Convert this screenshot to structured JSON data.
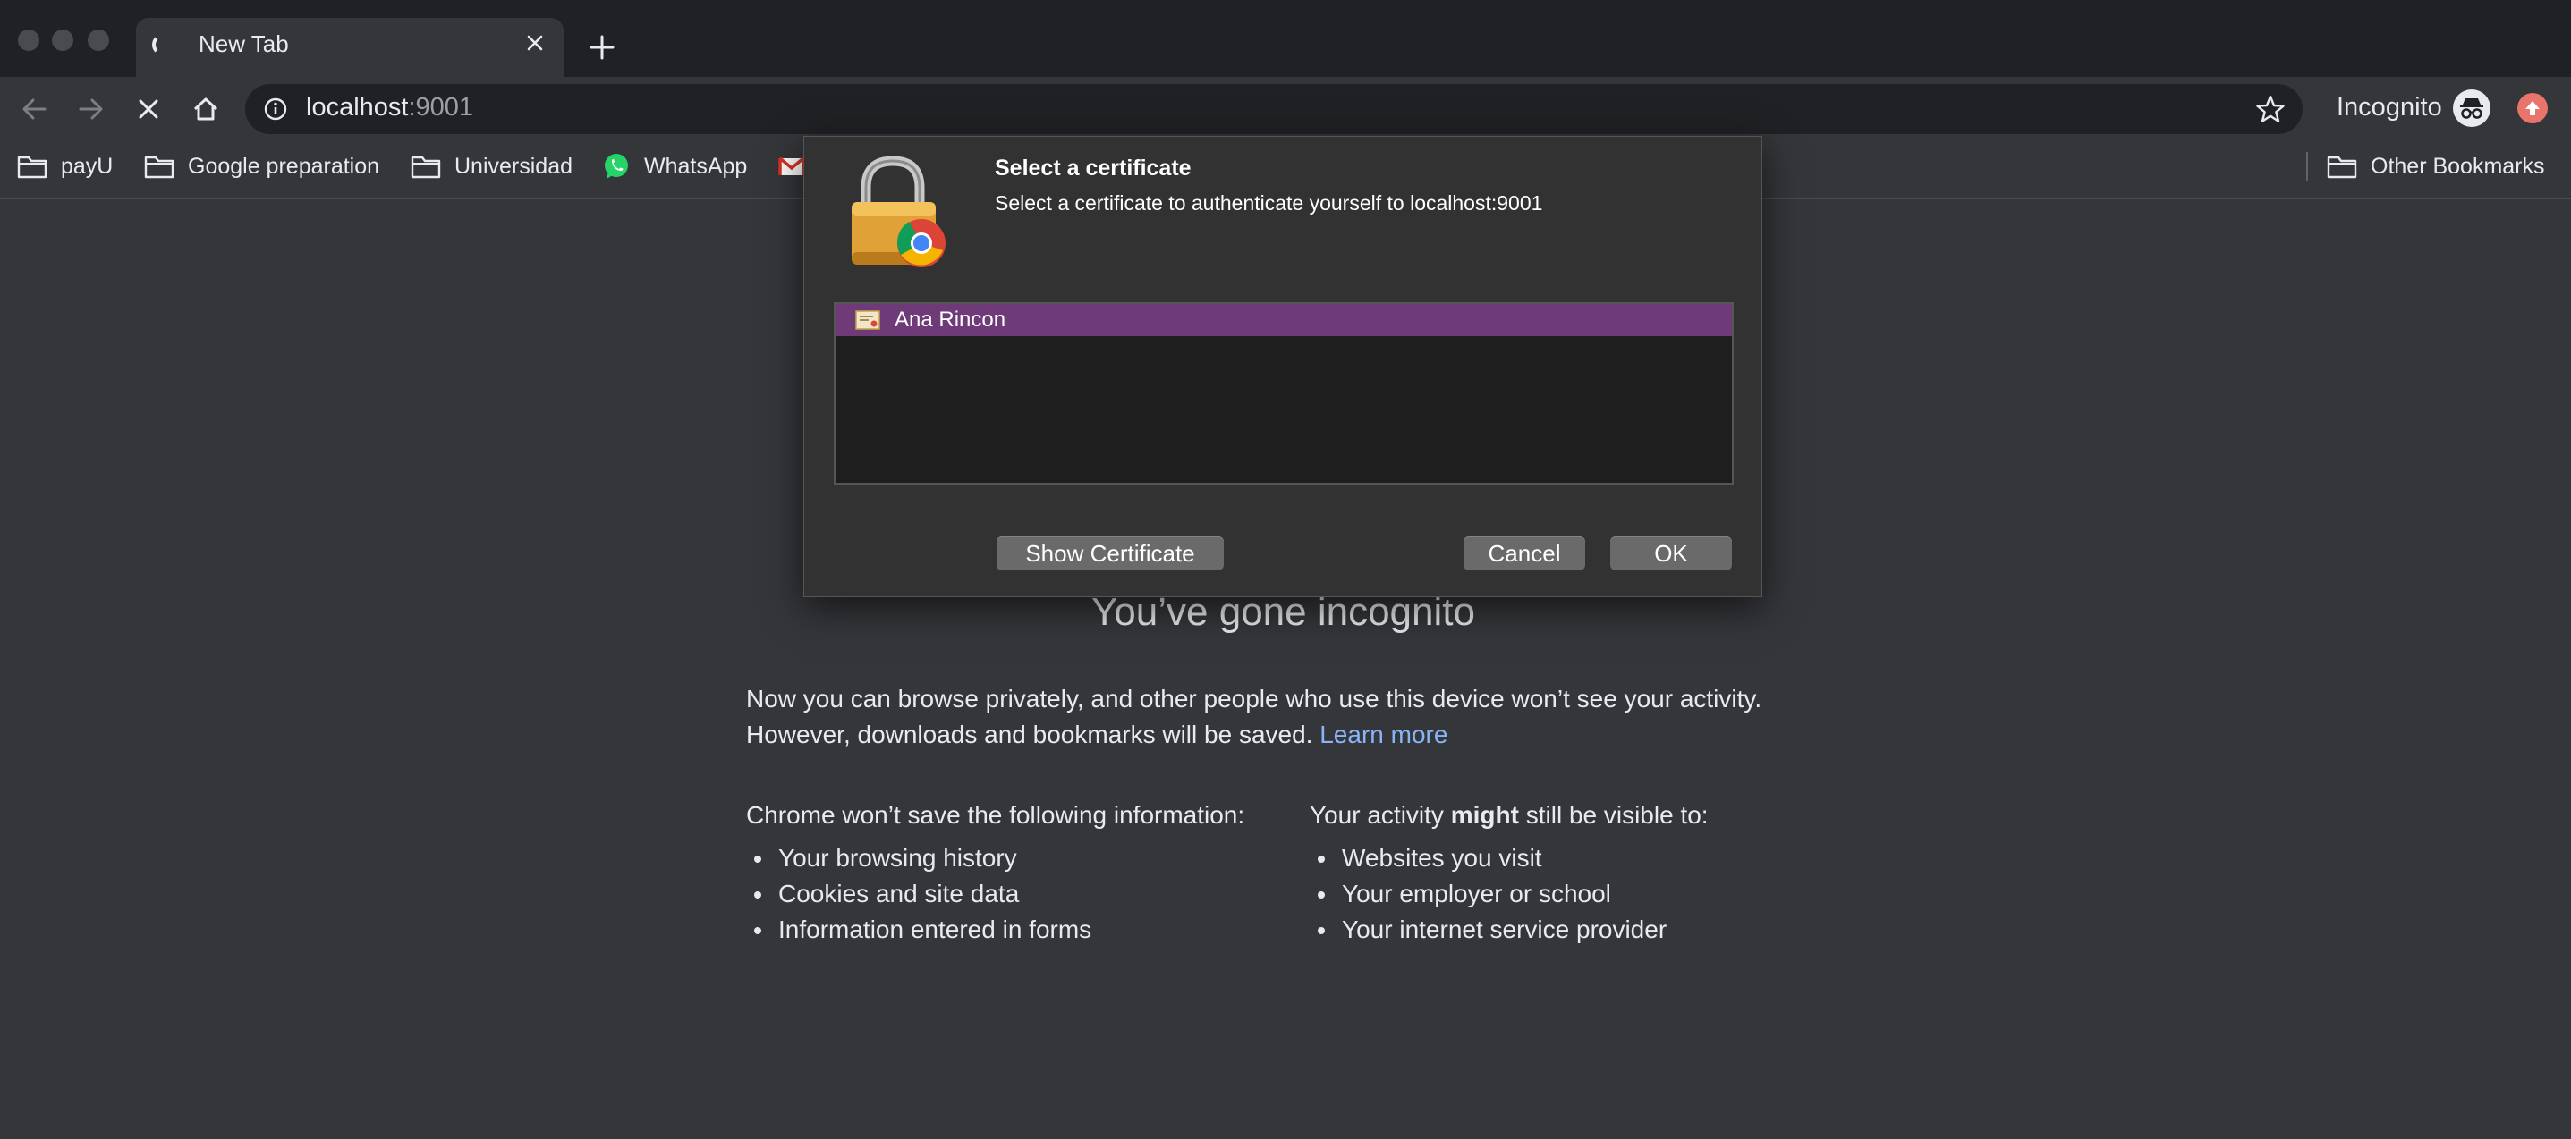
{
  "tab": {
    "title": "New Tab"
  },
  "omnibox": {
    "host": "localhost",
    "port": ":9001"
  },
  "profile": {
    "label": "Incognito"
  },
  "bookmarks": [
    {
      "label": "payU",
      "icon": "folder-icon"
    },
    {
      "label": "Google preparation",
      "icon": "folder-icon"
    },
    {
      "label": "Universidad",
      "icon": "folder-icon"
    },
    {
      "label": "WhatsApp",
      "icon": "whatsapp-icon"
    }
  ],
  "other_bookmarks": {
    "label": "Other Bookmarks",
    "icon": "folder-icon"
  },
  "page": {
    "title": "You’ve gone incognito",
    "intro_line1": "Now you can browse privately, and other people who use this device won’t see your activity.",
    "intro_line2": "However, downloads and bookmarks will be saved.",
    "learn_more": "Learn more",
    "left_heading": "Chrome won’t save the following information:",
    "left_items": [
      "Your browsing history",
      "Cookies and site data",
      "Information entered in forms"
    ],
    "right_heading_pre": "Your activity ",
    "right_heading_bold": "might",
    "right_heading_post": " still be visible to:",
    "right_items": [
      "Websites you visit",
      "Your employer or school",
      "Your internet service provider"
    ]
  },
  "dialog": {
    "title": "Select a certificate",
    "message": "Select a certificate to authenticate yourself to localhost:9001",
    "certificates": [
      "Ana Rincon"
    ],
    "show_button": "Show Certificate",
    "cancel_button": "Cancel",
    "ok_button": "OK"
  },
  "colors": {
    "window_bg": "#35363a",
    "frame_bg": "#202124",
    "selection": "#6f3a78",
    "link": "#8ab4f8"
  }
}
